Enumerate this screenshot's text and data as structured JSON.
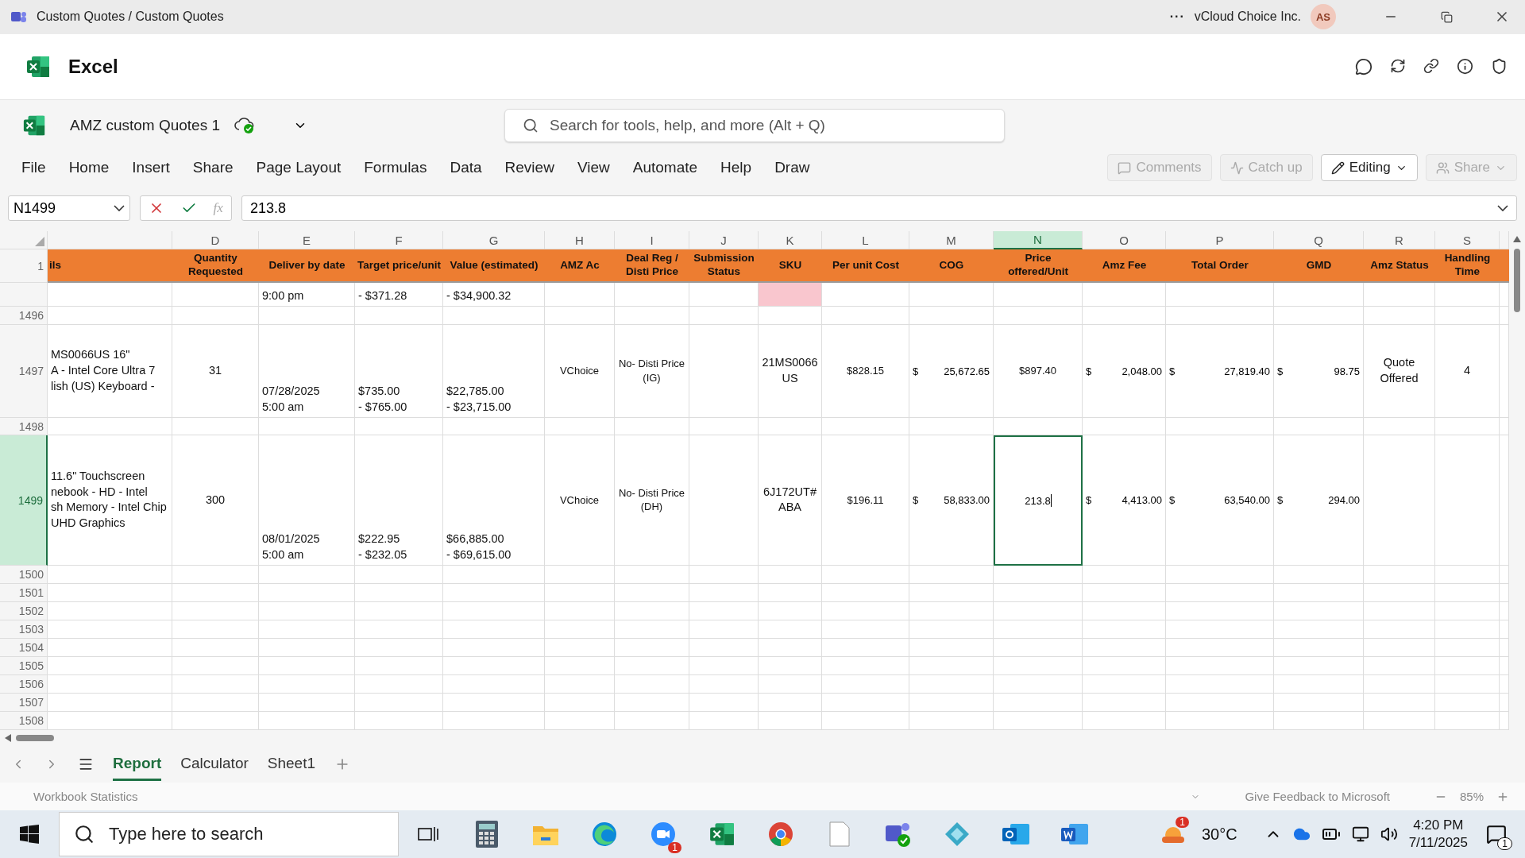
{
  "title_bar": {
    "title": "Custom Quotes / Custom Quotes",
    "more": "···",
    "org": "vCloud Choice Inc.",
    "avatar": "AS"
  },
  "app_header": {
    "name": "Excel"
  },
  "file_bar": {
    "name": "AMZ custom Quotes 1",
    "search": {
      "placeholder": "Search for tools, help, and more (Alt + Q)"
    }
  },
  "menu": [
    "File",
    "Home",
    "Insert",
    "Share",
    "Page Layout",
    "Formulas",
    "Data",
    "Review",
    "View",
    "Automate",
    "Help",
    "Draw"
  ],
  "actions": [
    {
      "label": "Comments",
      "disabled": true
    },
    {
      "label": "Catch up",
      "disabled": true
    },
    {
      "label": "Editing",
      "disabled": false
    },
    {
      "label": "Share",
      "disabled": true
    }
  ],
  "formula_bar": {
    "name_box": "N1499",
    "function_label": "fx",
    "value": "213.8"
  },
  "sheet": {
    "header_row": "1",
    "columns": [
      {
        "title": "ils",
        "selected": false
      },
      {
        "letter": "D",
        "title": "Quantity Requested",
        "selected": false
      },
      {
        "letter": "E",
        "title": "Deliver by date",
        "selected": false
      },
      {
        "letter": "F",
        "title": "Target price/unit",
        "selected": false
      },
      {
        "letter": "G",
        "title": "Value (estimated)",
        "selected": false
      },
      {
        "letter": "H",
        "title": "AMZ Ac",
        "selected": false
      },
      {
        "letter": "I",
        "title": "Deal Reg / Disti Price",
        "selected": false
      },
      {
        "letter": "J",
        "title": "Submission Status",
        "selected": false
      },
      {
        "letter": "K",
        "title": "SKU",
        "selected": false
      },
      {
        "letter": "L",
        "title": "Per unit Cost",
        "selected": false
      },
      {
        "letter": "M",
        "title": "COG",
        "selected": false
      },
      {
        "letter": "N",
        "title": "Price offered/Unit",
        "selected": true
      },
      {
        "letter": "O",
        "title": "Amz Fee",
        "selected": false
      },
      {
        "letter": "P",
        "title": "Total Order",
        "selected": false
      },
      {
        "letter": "Q",
        "title": "GMD",
        "selected": false
      },
      {
        "letter": "R",
        "title": "Amz Status",
        "selected": false
      },
      {
        "letter": "S",
        "title": "Handling Time",
        "selected": false
      }
    ],
    "rows": [
      {
        "selected": false,
        "cells": [
          null,
          null,
          "9:00 pm",
          "- $371.28",
          "- $34,900.32",
          null,
          null,
          null,
          {
            "color": "#f9c6ce"
          },
          null,
          null,
          null,
          null,
          null,
          null,
          null,
          null
        ]
      },
      {
        "number": "1496",
        "selected": false,
        "cells": []
      },
      {
        "number": "1497",
        "selected": false,
        "cells": [
          "MS0066US 16\"\nA - Intel Core Ultra 7\nlish (US) Keyboard -",
          "31",
          "07/28/2025\n5:00 am",
          "$735.00\n- $765.00",
          "$22,785.00\n- $23,715.00",
          "VChoice",
          "No- Disti Price\n(IG)",
          null,
          "21MS0066\nUS",
          "$828.15",
          {
            "currency": "$",
            "amount": "25,672.65"
          },
          "$897.40",
          {
            "currency": "$",
            "amount": "2,048.00"
          },
          {
            "currency": "$",
            "amount": "27,819.40"
          },
          {
            "currency": "$",
            "amount": "98.75"
          },
          "Quote\nOffered",
          "4"
        ]
      },
      {
        "number": "1498",
        "selected": false,
        "cells": []
      },
      {
        "number": "1499",
        "selected": true,
        "cells": [
          "11.6\" Touchscreen\nnebook - HD - Intel\nsh Memory - Intel Chip\nUHD Graphics",
          "300",
          "08/01/2025\n5:00 am",
          "$222.95\n- $232.05",
          "$66,885.00\n- $69,615.00",
          "VChoice",
          "No- Disti Price\n(DH)",
          null,
          "6J172UT#\nABA",
          "$196.11",
          {
            "currency": "$",
            "amount": "58,833.00"
          },
          {
            "text": "213.8",
            "active": true
          },
          {
            "currency": "$",
            "amount": "4,413.00"
          },
          {
            "currency": "$",
            "amount": "63,540.00"
          },
          {
            "currency": "$",
            "amount": "294.00"
          },
          null,
          null
        ]
      },
      {
        "number": "1500",
        "selected": false,
        "cells": []
      },
      {
        "number": "1501",
        "selected": false,
        "cells": []
      },
      {
        "number": "1502",
        "selected": false,
        "cells": []
      },
      {
        "number": "1503",
        "selected": false,
        "cells": []
      },
      {
        "number": "1504",
        "selected": false,
        "cells": []
      },
      {
        "number": "1505",
        "selected": false,
        "cells": []
      },
      {
        "number": "1506",
        "selected": false,
        "cells": []
      },
      {
        "number": "1507",
        "selected": false,
        "cells": []
      },
      {
        "number": "1508",
        "selected": false,
        "cells": []
      }
    ]
  },
  "sheet_tabs": [
    {
      "label": "Report",
      "selected": true
    },
    {
      "label": "Calculator",
      "selected": false
    },
    {
      "label": "Sheet1",
      "selected": false
    }
  ],
  "status_bar": {
    "left": "Workbook Statistics",
    "feedback": "Give Feedback to Microsoft",
    "zoom": "85%"
  },
  "taskbar": {
    "search": {
      "placeholder": "Type here to search"
    },
    "zoom_badge": "1",
    "weather_badge": "1",
    "temperature": "30°C",
    "time": "4:20 PM",
    "date": "7/11/2025",
    "notifications": "1"
  }
}
